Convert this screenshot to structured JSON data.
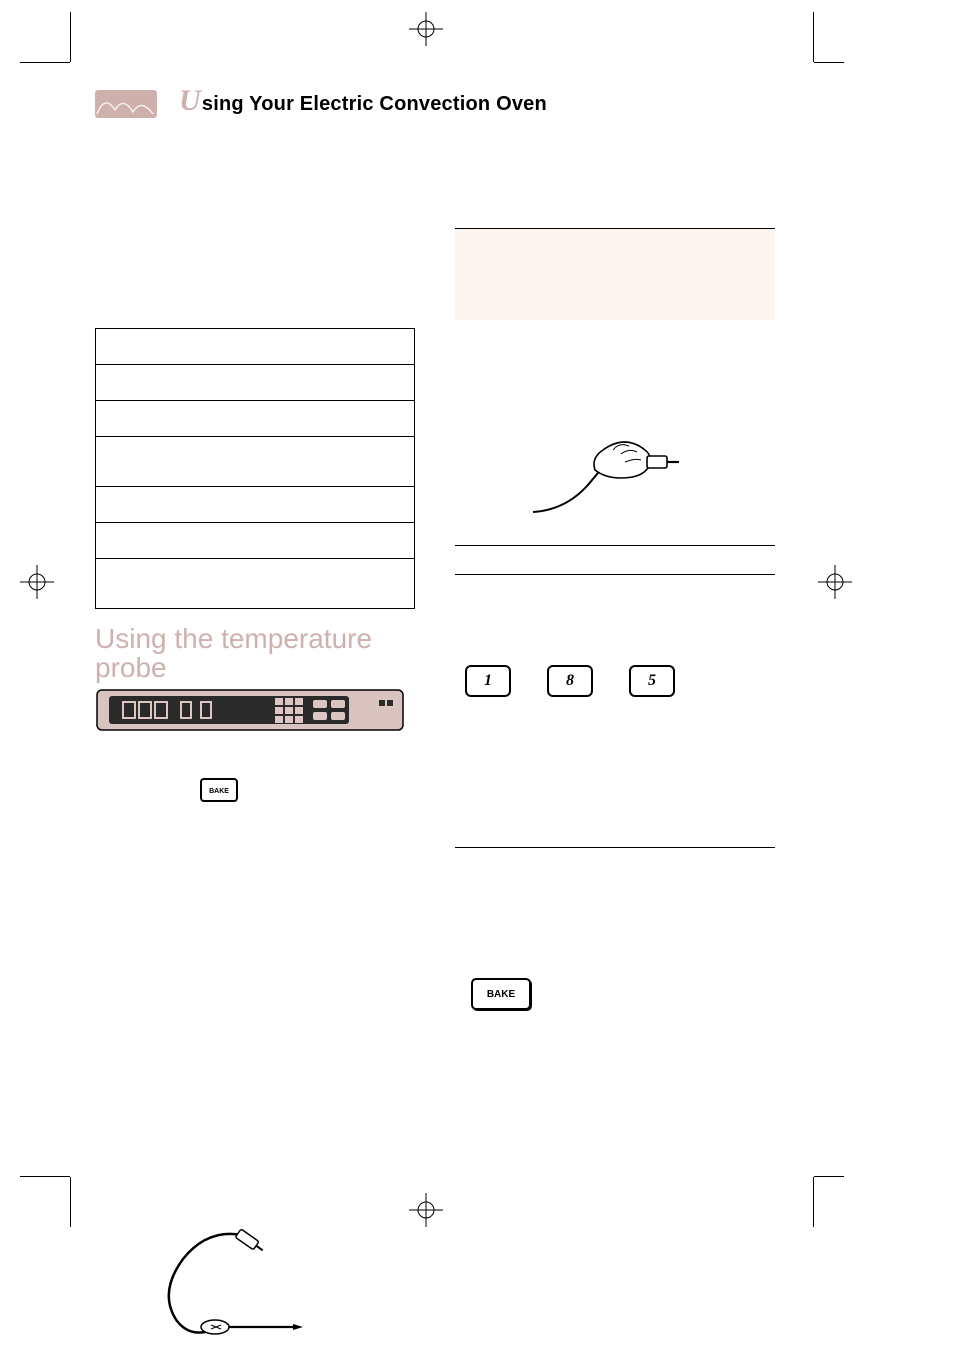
{
  "header": {
    "drop_letter": "U",
    "title_rest": "sing Your Electric Convection Oven"
  },
  "left": {
    "subhead": "Using the temperature probe",
    "panel_bake_label": "BAKE",
    "bullets": [
      "",
      ""
    ]
  },
  "right": {
    "keypad": [
      "1",
      "8",
      "5"
    ],
    "bullets": [
      "",
      "",
      ""
    ],
    "bake_label": "BAKE"
  },
  "icons": {
    "logo": "brand-logo",
    "reg_mark": "registration-mark",
    "hand": "hand-plugging-probe",
    "probe": "temperature-probe",
    "control_panel": "oven-control-panel"
  }
}
